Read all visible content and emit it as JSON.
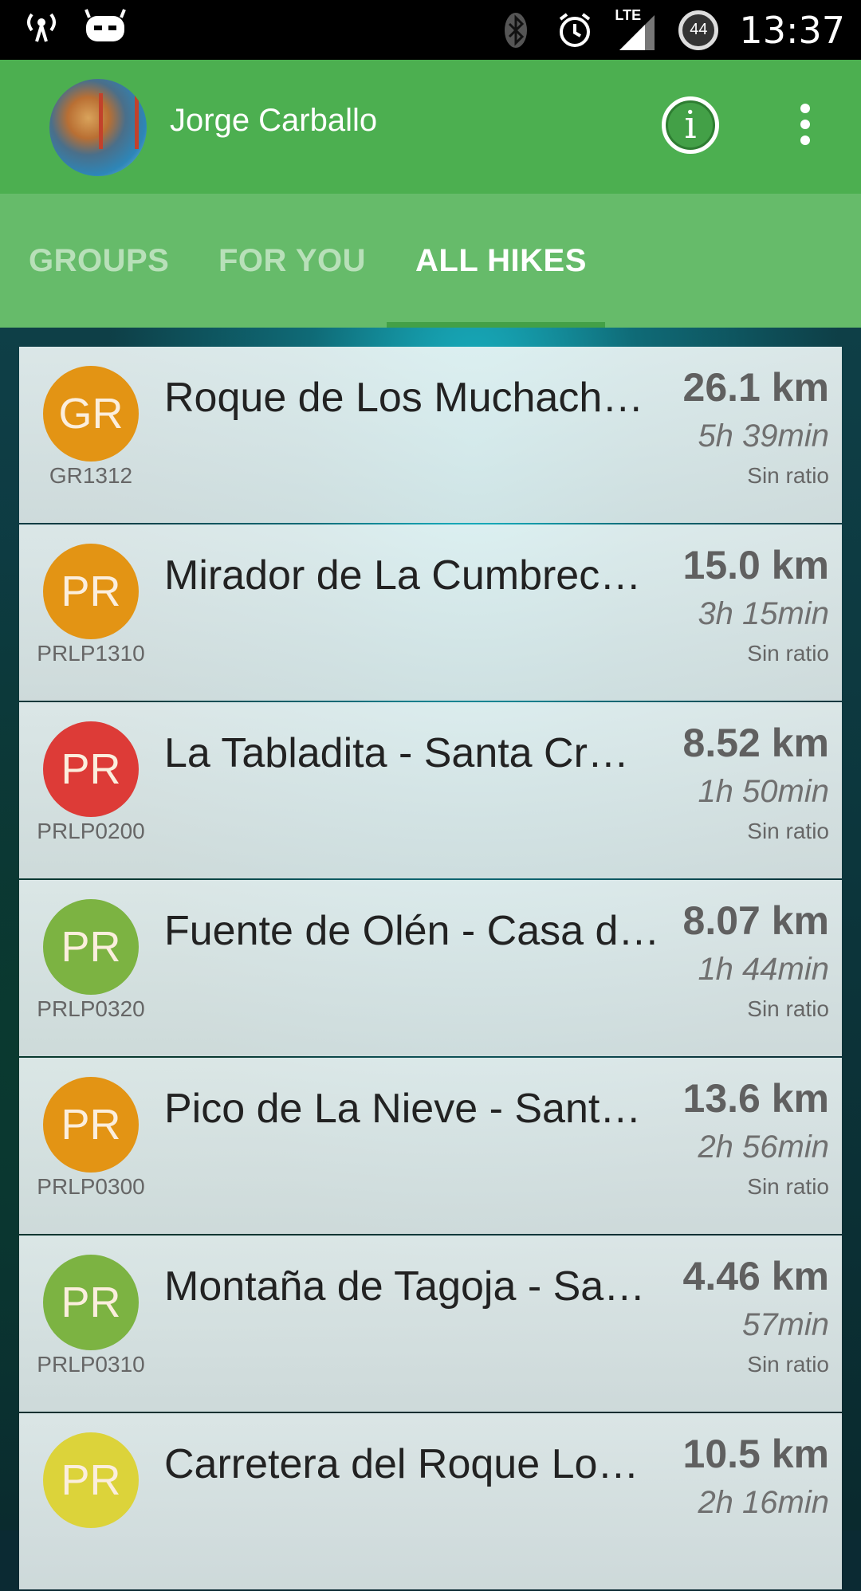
{
  "status_bar": {
    "time": "13:37",
    "battery_level": "44",
    "network": "LTE",
    "icons": [
      "signal-tower-icon",
      "cyanogen-icon",
      "bluetooth-icon",
      "alarm-icon",
      "lte-signal-icon",
      "battery-icon"
    ]
  },
  "app_bar": {
    "user_name": "Jorge Carballo",
    "info_icon": "info-icon",
    "overflow_icon": "more-vert-icon"
  },
  "tabs": [
    {
      "label": "GROUPS",
      "active": false
    },
    {
      "label": "FOR YOU",
      "active": false
    },
    {
      "label": "ALL HIKES",
      "active": true
    }
  ],
  "hikes": [
    {
      "badge": "GR",
      "badge_color": "#e39414",
      "code": "GR1312",
      "title": "Roque de Los Muchach…",
      "distance": "26.1 km",
      "duration": "5h 39min",
      "ratio": "Sin ratio"
    },
    {
      "badge": "PR",
      "badge_color": "#e39414",
      "code": "PRLP1310",
      "title": "Mirador de La Cumbrec…",
      "distance": "15.0 km",
      "duration": "3h 15min",
      "ratio": "Sin ratio"
    },
    {
      "badge": "PR",
      "badge_color": "#dd3b37",
      "code": "PRLP0200",
      "title": "La Tabladita - Santa Cr…",
      "distance": "8.52 km",
      "duration": "1h 50min",
      "ratio": "Sin ratio"
    },
    {
      "badge": "PR",
      "badge_color": "#7cb342",
      "code": "PRLP0320",
      "title": "Fuente de Olén - Casa d…",
      "distance": "8.07 km",
      "duration": "1h 44min",
      "ratio": "Sin ratio"
    },
    {
      "badge": "PR",
      "badge_color": "#e39414",
      "code": "PRLP0300",
      "title": "Pico de La Nieve - Sant…",
      "distance": "13.6 km",
      "duration": "2h 56min",
      "ratio": "Sin ratio"
    },
    {
      "badge": "PR",
      "badge_color": "#7cb342",
      "code": "PRLP0310",
      "title": "Montaña de Tagoja - Sa…",
      "distance": "4.46 km",
      "duration": "57min",
      "ratio": "Sin ratio"
    },
    {
      "badge": "PR",
      "badge_color": "#dcd33a",
      "code": "",
      "title": "Carretera del Roque Lo…",
      "distance": "10.5 km",
      "duration": "2h 16min",
      "ratio": ""
    }
  ]
}
